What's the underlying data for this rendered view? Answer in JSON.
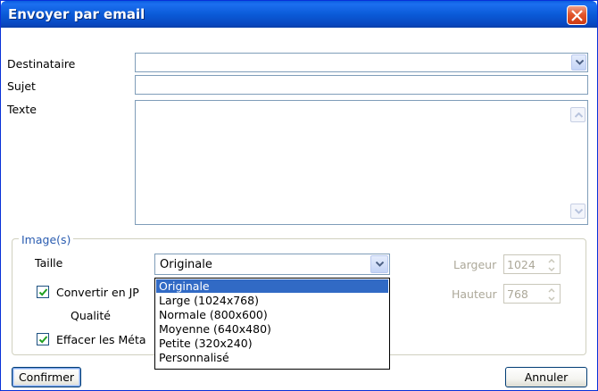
{
  "window": {
    "title": "Envoyer par email"
  },
  "form": {
    "recipient_label": "Destinataire",
    "recipient_value": "",
    "subject_label": "Sujet",
    "subject_value": "",
    "text_label": "Texte",
    "text_value": ""
  },
  "images_group": {
    "title": "Image(s)",
    "size_label": "Taille",
    "size_selected": "Originale",
    "size_options": [
      "Originale",
      "Large (1024x768)",
      "Normale (800x600)",
      "Moyenne (640x480)",
      "Petite (320x240)",
      "Personnalisé"
    ],
    "convert_label": "Convertir en JPEG",
    "convert_visible": "Convertir en JP",
    "convert_checked": true,
    "quality_label": "Qualité",
    "erase_meta_label": "Effacer les Métadonnées",
    "erase_meta_visible": "Effacer les Méta",
    "erase_meta_checked": true,
    "width_label": "Largeur",
    "width_value": "1024",
    "height_label": "Hauteur",
    "height_value": "768"
  },
  "buttons": {
    "confirm": "Confirmer",
    "cancel": "Annuler"
  },
  "colors": {
    "titlebar": "#0b5bd8",
    "selection": "#316ac5",
    "group_title": "#2a5cb0",
    "disabled_text": "#aca899"
  }
}
